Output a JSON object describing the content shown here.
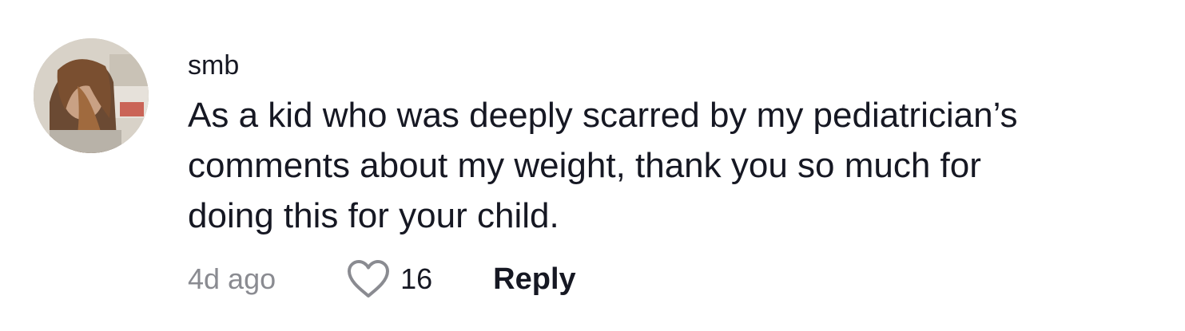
{
  "comment": {
    "avatar_icon": "user-avatar-photo",
    "username": "smb",
    "text_lines": [
      "As a kid who was deeply scarred by my pediatrician’s",
      "comments about my weight, thank you so much for",
      "doing this for your child."
    ],
    "timestamp": "4d ago",
    "like_icon": "heart-outline-icon",
    "like_count": "16",
    "reply_label": "Reply"
  },
  "colors": {
    "text_primary": "#161823",
    "text_secondary": "#8a8b91",
    "heart_stroke": "#8a8b91",
    "background": "#ffffff"
  }
}
